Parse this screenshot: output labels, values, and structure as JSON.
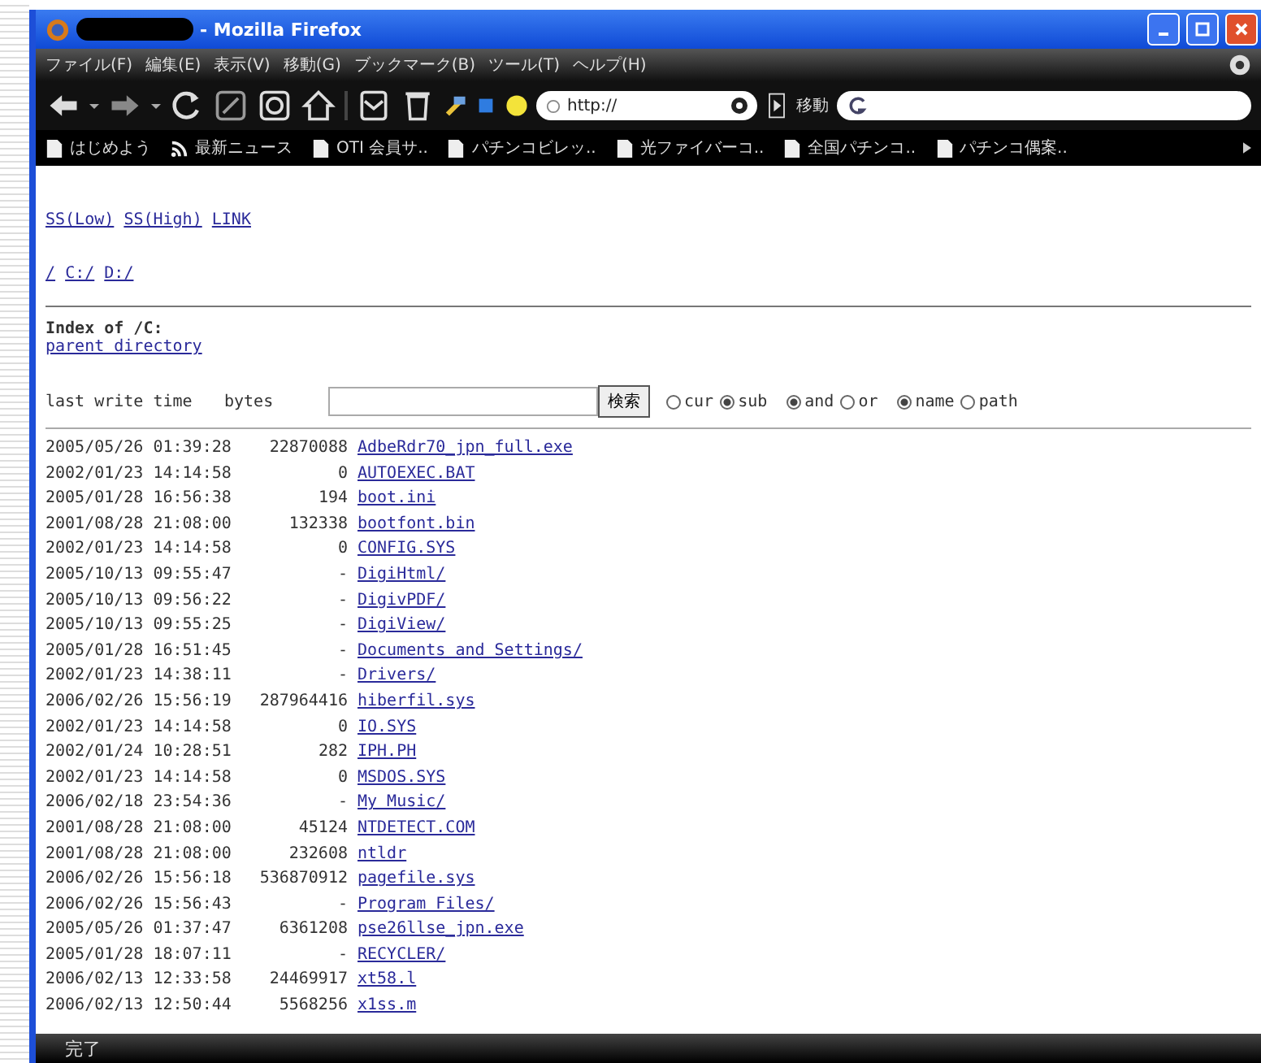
{
  "window": {
    "title": "- Mozilla Firefox"
  },
  "menu": [
    "ファイル(F)",
    "編集(E)",
    "表示(V)",
    "移動(G)",
    "ブックマーク(B)",
    "ツール(T)",
    "ヘルプ(H)"
  ],
  "toolbar": {
    "address": "http://",
    "go_label": "移動"
  },
  "bookmarks": [
    {
      "label": "はじめよう",
      "kind": "page"
    },
    {
      "label": "最新ニュース",
      "kind": "feed"
    },
    {
      "label": "OTI 会員サ..",
      "kind": "page"
    },
    {
      "label": "パチンコビレッ..",
      "kind": "page"
    },
    {
      "label": "光ファイバーコ..",
      "kind": "page"
    },
    {
      "label": "全国パチンコ..",
      "kind": "page"
    },
    {
      "label": "パチンコ偶案..",
      "kind": "page"
    }
  ],
  "page": {
    "top_links": [
      "SS(Low)",
      "SS(High)",
      "LINK"
    ],
    "drive_links": [
      "/",
      "C:/",
      "D:/"
    ],
    "heading": "Index of /C:",
    "parent_link": "parent directory",
    "columns": [
      "last write time",
      "bytes"
    ],
    "search_button": "検索",
    "radio_groups": [
      [
        {
          "label": "cur",
          "selected": false
        },
        {
          "label": "sub",
          "selected": true
        }
      ],
      [
        {
          "label": "and",
          "selected": true
        },
        {
          "label": "or",
          "selected": false
        }
      ],
      [
        {
          "label": "name",
          "selected": true
        },
        {
          "label": "path",
          "selected": false
        }
      ]
    ],
    "rows": [
      [
        "2005/05/26 01:39:28",
        "22870088",
        "AdbeRdr70_jpn_full.exe"
      ],
      [
        "2002/01/23 14:14:58",
        "0",
        "AUTOEXEC.BAT"
      ],
      [
        "2005/01/28 16:56:38",
        "194",
        "boot.ini"
      ],
      [
        "2001/08/28 21:08:00",
        "132338",
        "bootfont.bin"
      ],
      [
        "2002/01/23 14:14:58",
        "0",
        "CONFIG.SYS"
      ],
      [
        "2005/10/13 09:55:47",
        "-",
        "DigiHtml/"
      ],
      [
        "2005/10/13 09:56:22",
        "-",
        "DigivPDF/"
      ],
      [
        "2005/10/13 09:55:25",
        "-",
        "DigiView/"
      ],
      [
        "2005/01/28 16:51:45",
        "-",
        "Documents and Settings/"
      ],
      [
        "2002/01/23 14:38:11",
        "-",
        "Drivers/"
      ],
      [
        "2006/02/26 15:56:19",
        "287964416",
        "hiberfil.sys"
      ],
      [
        "2002/01/23 14:14:58",
        "0",
        "IO.SYS"
      ],
      [
        "2002/01/24 10:28:51",
        "282",
        "IPH.PH"
      ],
      [
        "2002/01/23 14:14:58",
        "0",
        "MSDOS.SYS"
      ],
      [
        "2006/02/18 23:54:36",
        "-",
        "My Music/"
      ],
      [
        "2001/08/28 21:08:00",
        "45124",
        "NTDETECT.COM"
      ],
      [
        "2001/08/28 21:08:00",
        "232608",
        "ntldr"
      ],
      [
        "2006/02/26 15:56:18",
        "536870912",
        "pagefile.sys"
      ],
      [
        "2006/02/26 15:56:43",
        "-",
        "Program Files/"
      ],
      [
        "2005/05/26 01:37:47",
        "6361208",
        "pse26llse_jpn.exe"
      ],
      [
        "2005/01/28 18:07:11",
        "-",
        "RECYCLER/"
      ],
      [
        "2006/02/13 12:33:58",
        "24469917",
        "xt58.l"
      ],
      [
        "2006/02/13 12:50:44",
        "5568256",
        "x1ss.m"
      ]
    ]
  },
  "status_bar": "完了"
}
